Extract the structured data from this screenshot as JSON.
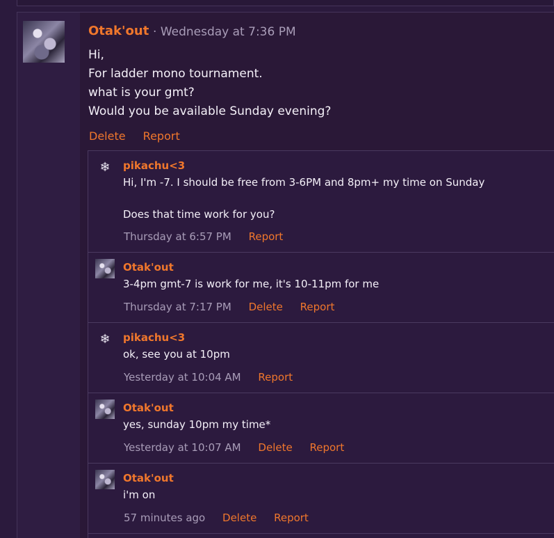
{
  "post": {
    "author": "Otak'out",
    "separator": "·",
    "timestamp": "Wednesday at 7:36 PM",
    "lines": [
      "Hi,",
      "For ladder mono tournament.",
      "what is your gmt?",
      "Would you be available Sunday evening?"
    ],
    "actions": {
      "delete": "Delete",
      "report": "Report"
    }
  },
  "comments": [
    {
      "author": "pikachu<3",
      "text": "Hi, I'm -7. I should be free from 3-6PM and 8pm+ my time on Sunday\n\nDoes that time work for you?",
      "time": "Thursday at 6:57 PM",
      "delete": "",
      "report": "Report"
    },
    {
      "author": "Otak'out",
      "text": "3-4pm gmt-7 is work for me, it's 10-11pm for me",
      "time": "Thursday at 7:17 PM",
      "delete": "Delete",
      "report": "Report"
    },
    {
      "author": "pikachu<3",
      "text": "ok, see you at 10pm",
      "time": "Yesterday at 10:04 AM",
      "delete": "",
      "report": "Report"
    },
    {
      "author": "Otak'out",
      "text": "yes, sunday 10pm my time*",
      "time": "Yesterday at 10:07 AM",
      "delete": "Delete",
      "report": "Report"
    },
    {
      "author": "Otak'out",
      "text": "i'm on",
      "time": "57 minutes ago",
      "delete": "Delete",
      "report": "Report"
    }
  ],
  "icons": {
    "pikachu_avatar": "paw-icon",
    "otak_avatar": "anime-avatar"
  },
  "colors": {
    "accent": "#f0772c",
    "muted": "#a99db8",
    "background": "#2a1837"
  }
}
